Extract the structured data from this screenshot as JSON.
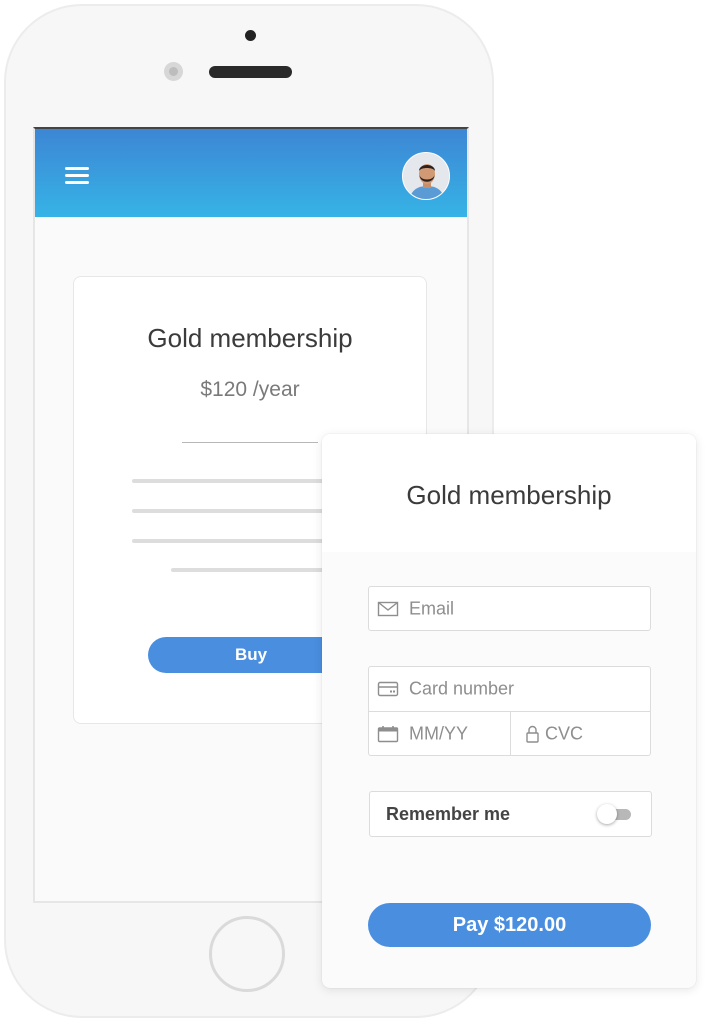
{
  "colors": {
    "header_gradient_start": "#3d86d4",
    "header_gradient_end": "#36b3e6",
    "accent_button": "#4a8ee0",
    "phone_body": "#f7f7f7"
  },
  "header": {
    "menu_icon": "hamburger-menu-icon",
    "avatar_icon": "user-avatar"
  },
  "product_card": {
    "title": "Gold membership",
    "price": "$120 /year",
    "buy_label": "Buy"
  },
  "payment_form": {
    "title": "Gold membership",
    "email_placeholder": "Email",
    "card_number_placeholder": "Card number",
    "expiry_placeholder": "MM/YY",
    "cvc_placeholder": "CVC",
    "remember_label": "Remember me",
    "remember_enabled": false,
    "pay_label": "Pay $120.00",
    "icons": {
      "email": "envelope-icon",
      "card": "credit-card-icon",
      "expiry": "calendar-icon",
      "cvc": "lock-icon"
    }
  }
}
